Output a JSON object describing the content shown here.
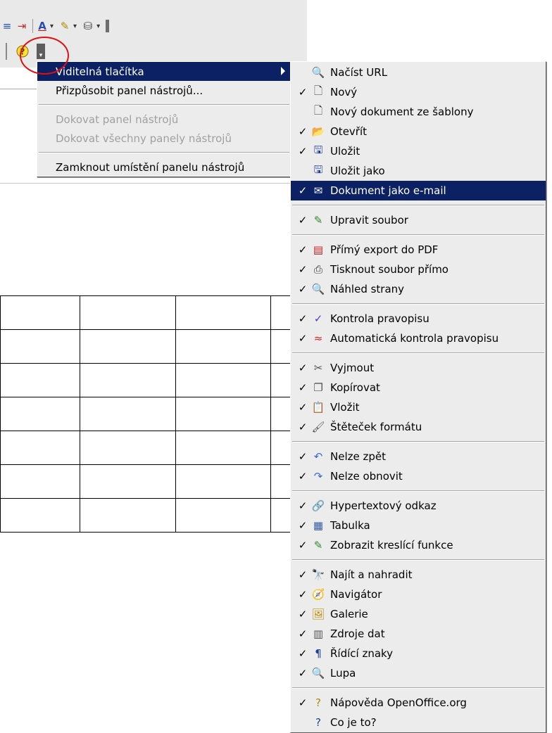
{
  "toolbar": {
    "row1_icons": [
      "indent-decrease-icon",
      "indent-increase-icon",
      "font-color-icon",
      "highlight-icon",
      "background-color-icon"
    ],
    "row2_icons": [
      "help-icon",
      "toolbar-options-icon"
    ]
  },
  "context_menu": {
    "items": [
      {
        "label": "Viditelná tlačítka",
        "state": "highlighted",
        "has_submenu": true
      },
      {
        "label": "Přizpůsobit panel nástrojů...",
        "state": "enabled"
      },
      {
        "label": "Dokovat panel nástrojů",
        "state": "disabled"
      },
      {
        "label": "Dokovat všechny panely nástrojů",
        "state": "disabled"
      },
      {
        "label": "Zamknout umístění panelu nástrojů",
        "state": "enabled"
      }
    ]
  },
  "submenu": {
    "groups": [
      [
        {
          "label": "Načíst URL",
          "checked": false,
          "icon": "load-url-icon"
        },
        {
          "label": "Nový",
          "checked": true,
          "icon": "new-document-icon"
        },
        {
          "label": "Nový dokument ze šablony",
          "checked": false,
          "icon": "template-icon"
        },
        {
          "label": "Otevřít",
          "checked": true,
          "icon": "open-folder-icon"
        },
        {
          "label": "Uložit",
          "checked": true,
          "icon": "save-icon"
        },
        {
          "label": "Uložit jako",
          "checked": false,
          "icon": "save-as-icon"
        },
        {
          "label": "Dokument jako e-mail",
          "checked": true,
          "icon": "email-icon",
          "highlighted": true
        }
      ],
      [
        {
          "label": "Upravit soubor",
          "checked": true,
          "icon": "edit-file-icon"
        }
      ],
      [
        {
          "label": "Přímý export do PDF",
          "checked": true,
          "icon": "pdf-icon"
        },
        {
          "label": "Tisknout soubor přímo",
          "checked": true,
          "icon": "print-icon"
        },
        {
          "label": "Náhled strany",
          "checked": true,
          "icon": "page-preview-icon"
        }
      ],
      [
        {
          "label": "Kontrola pravopisu",
          "checked": true,
          "icon": "spellcheck-icon"
        },
        {
          "label": "Automatická kontrola pravopisu",
          "checked": true,
          "icon": "autospell-icon"
        }
      ],
      [
        {
          "label": "Vyjmout",
          "checked": true,
          "icon": "cut-icon"
        },
        {
          "label": "Kopírovat",
          "checked": true,
          "icon": "copy-icon"
        },
        {
          "label": "Vložit",
          "checked": true,
          "icon": "paste-icon"
        },
        {
          "label": "Štěteček formátu",
          "checked": true,
          "icon": "format-paintbrush-icon"
        }
      ],
      [
        {
          "label": "Nelze zpět",
          "checked": true,
          "icon": "undo-icon"
        },
        {
          "label": "Nelze obnovit",
          "checked": true,
          "icon": "redo-icon"
        }
      ],
      [
        {
          "label": "Hypertextový odkaz",
          "checked": true,
          "icon": "hyperlink-icon"
        },
        {
          "label": "Tabulka",
          "checked": true,
          "icon": "table-icon"
        },
        {
          "label": "Zobrazit kreslící funkce",
          "checked": true,
          "icon": "draw-functions-icon"
        }
      ],
      [
        {
          "label": "Najít a nahradit",
          "checked": true,
          "icon": "find-replace-icon"
        },
        {
          "label": "Navigátor",
          "checked": true,
          "icon": "navigator-icon"
        },
        {
          "label": "Galerie",
          "checked": true,
          "icon": "gallery-icon"
        },
        {
          "label": "Zdroje dat",
          "checked": true,
          "icon": "data-sources-icon"
        },
        {
          "label": "Řídící znaky",
          "checked": true,
          "icon": "formatting-marks-icon"
        },
        {
          "label": "Lupa",
          "checked": true,
          "icon": "zoom-icon"
        }
      ],
      [
        {
          "label": "Nápověda OpenOffice.org",
          "checked": true,
          "icon": "help-icon"
        },
        {
          "label": "Co je to?",
          "checked": false,
          "icon": "whats-this-icon"
        }
      ]
    ]
  },
  "colors": {
    "highlight": "#0b2163",
    "annotation": "#e01010",
    "menu_bg": "#ececec"
  }
}
